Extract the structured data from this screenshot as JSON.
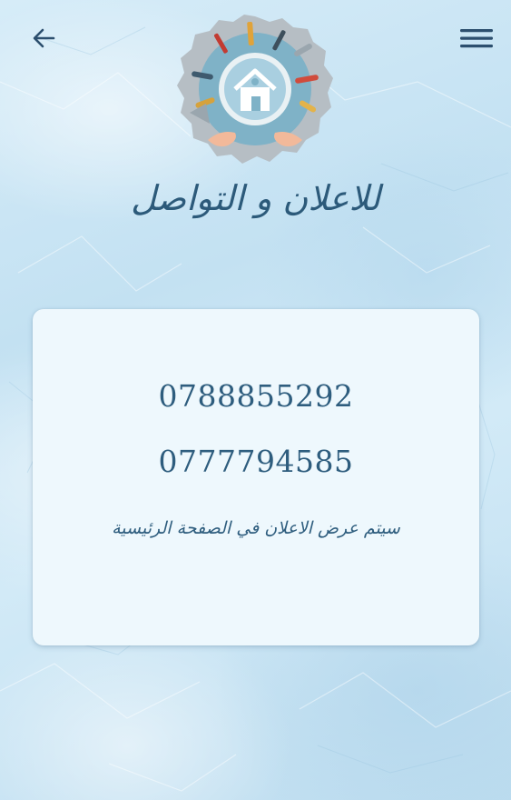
{
  "header": {
    "back_icon": "arrow-left-icon",
    "menu_icon": "hamburger-menu-icon",
    "logo_icon": "home-tools-logo"
  },
  "page": {
    "title": "للاعلان و التواصل"
  },
  "contact_card": {
    "phones": [
      "0788855292",
      "0777794585"
    ],
    "note": "سيتم عرض الاعلان في الصفحة الرئيسية"
  },
  "colors": {
    "accent": "#2c5a7a",
    "card_background": "#eef8fd",
    "page_background": "#c8e4f4"
  }
}
